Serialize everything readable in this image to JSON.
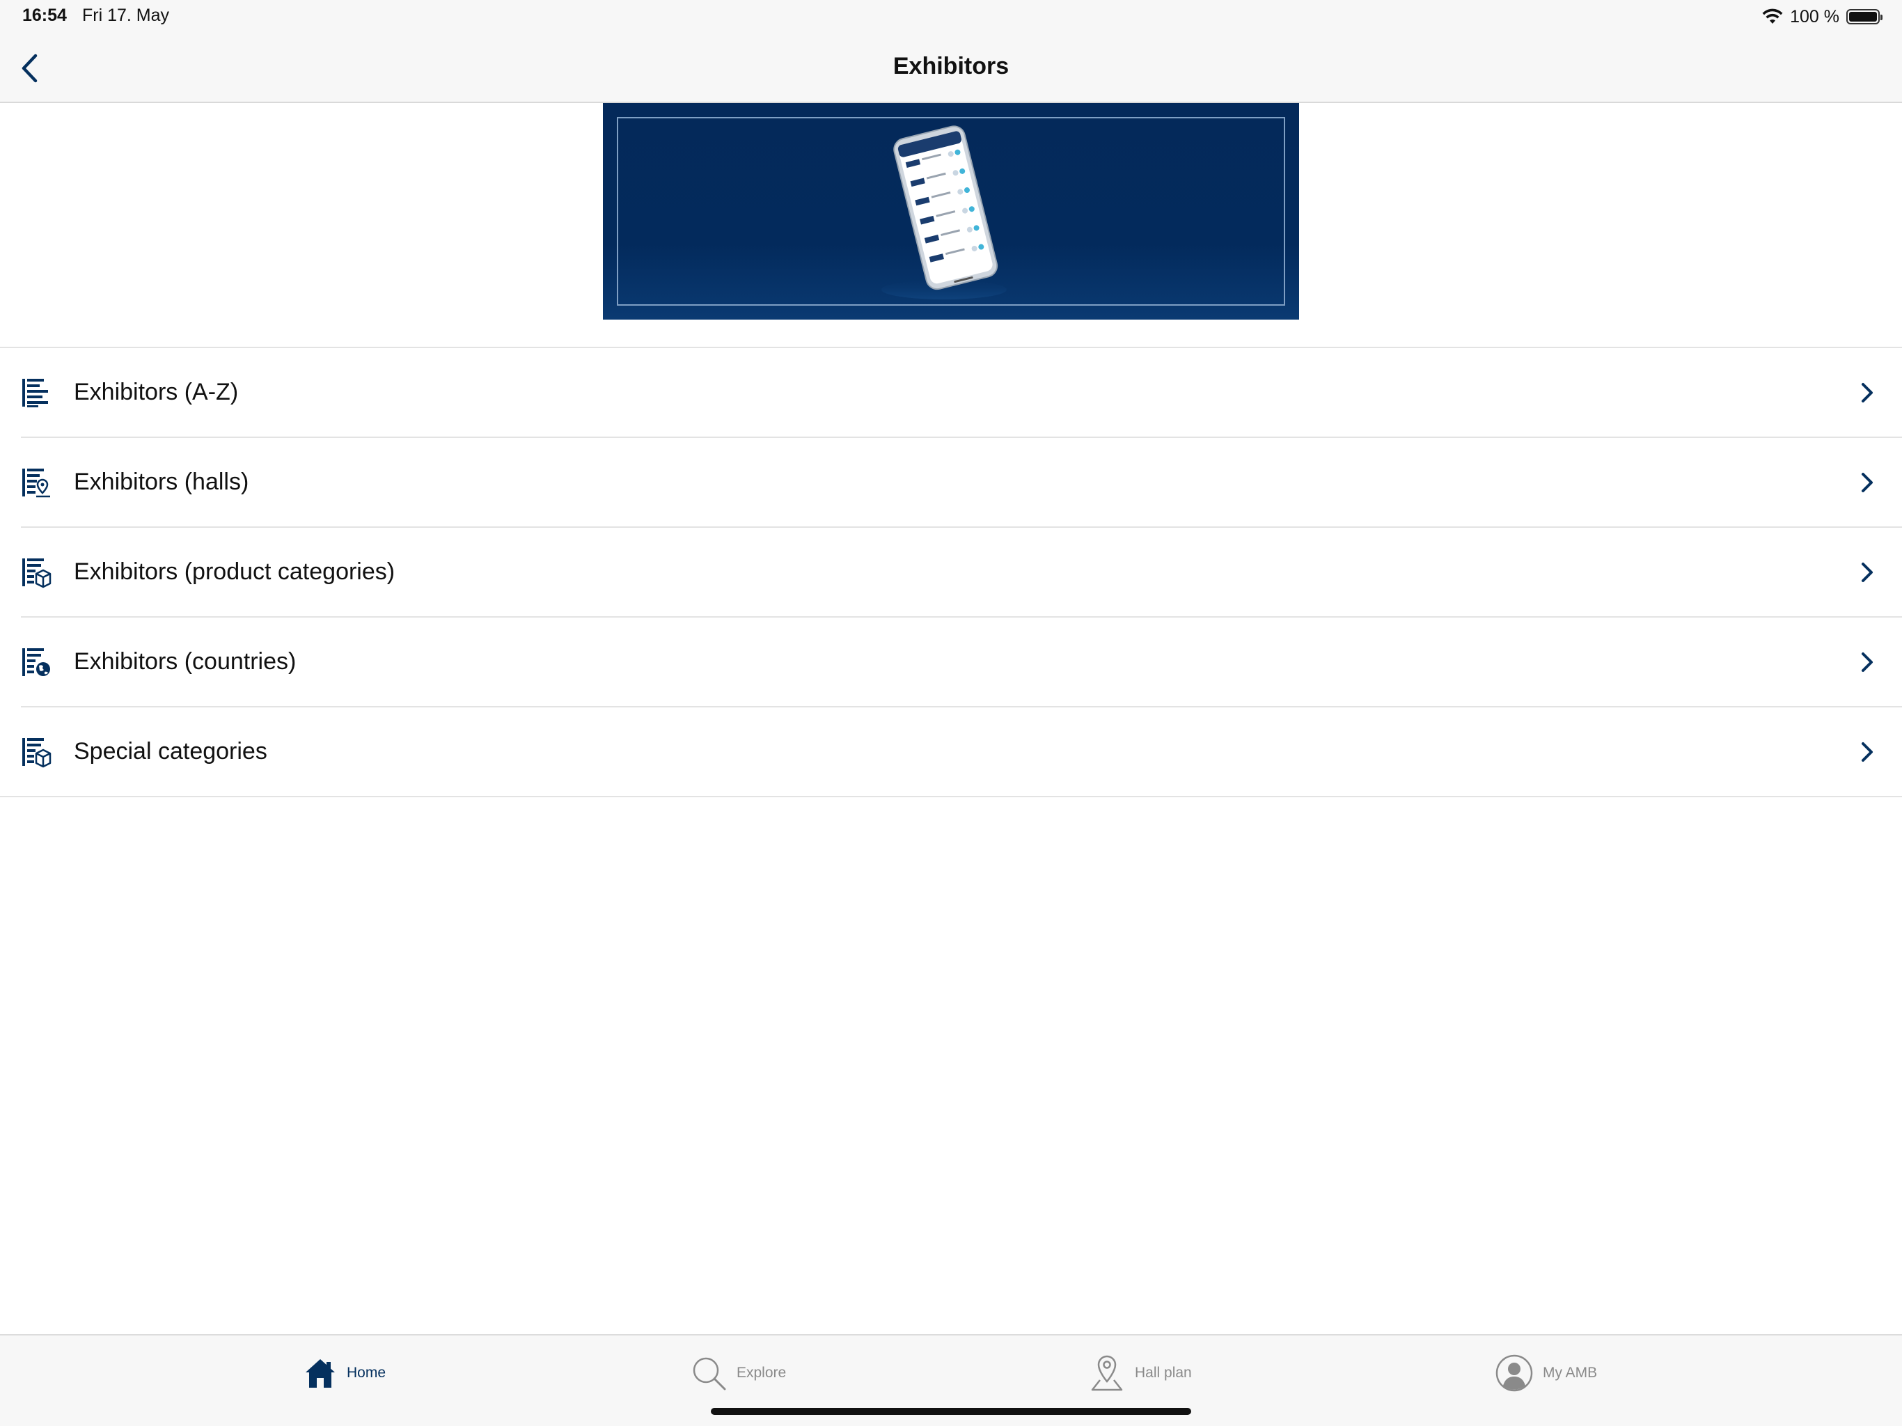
{
  "status_bar": {
    "time": "16:54",
    "date": "Fri 17. May",
    "battery_text": "100 %",
    "icons": [
      "wifi-icon",
      "battery-icon"
    ]
  },
  "nav": {
    "title": "Exhibitors",
    "back_icon": "chevron-left-icon"
  },
  "banner": {
    "description_icon": "phone-mockup-image",
    "background_color": "#032a5c"
  },
  "menu": {
    "items": [
      {
        "label": "Exhibitors (A-Z)",
        "icon": "list-icon"
      },
      {
        "label": "Exhibitors (halls)",
        "icon": "list-location-icon"
      },
      {
        "label": "Exhibitors (product categories)",
        "icon": "list-box-icon"
      },
      {
        "label": "Exhibitors (countries)",
        "icon": "list-globe-icon"
      },
      {
        "label": "Special categories",
        "icon": "list-box-icon"
      }
    ],
    "chevron_icon": "chevron-right-icon"
  },
  "tab_bar": {
    "tabs": [
      {
        "label": "Home",
        "icon": "home-icon",
        "active": true
      },
      {
        "label": "Explore",
        "icon": "search-icon",
        "active": false
      },
      {
        "label": "Hall plan",
        "icon": "map-pin-icon",
        "active": false
      },
      {
        "label": "My AMB",
        "icon": "user-icon",
        "active": false
      }
    ]
  },
  "colors": {
    "accent": "#05305e",
    "inactive": "#8a8a8a",
    "bar_background": "#f7f7f7"
  }
}
